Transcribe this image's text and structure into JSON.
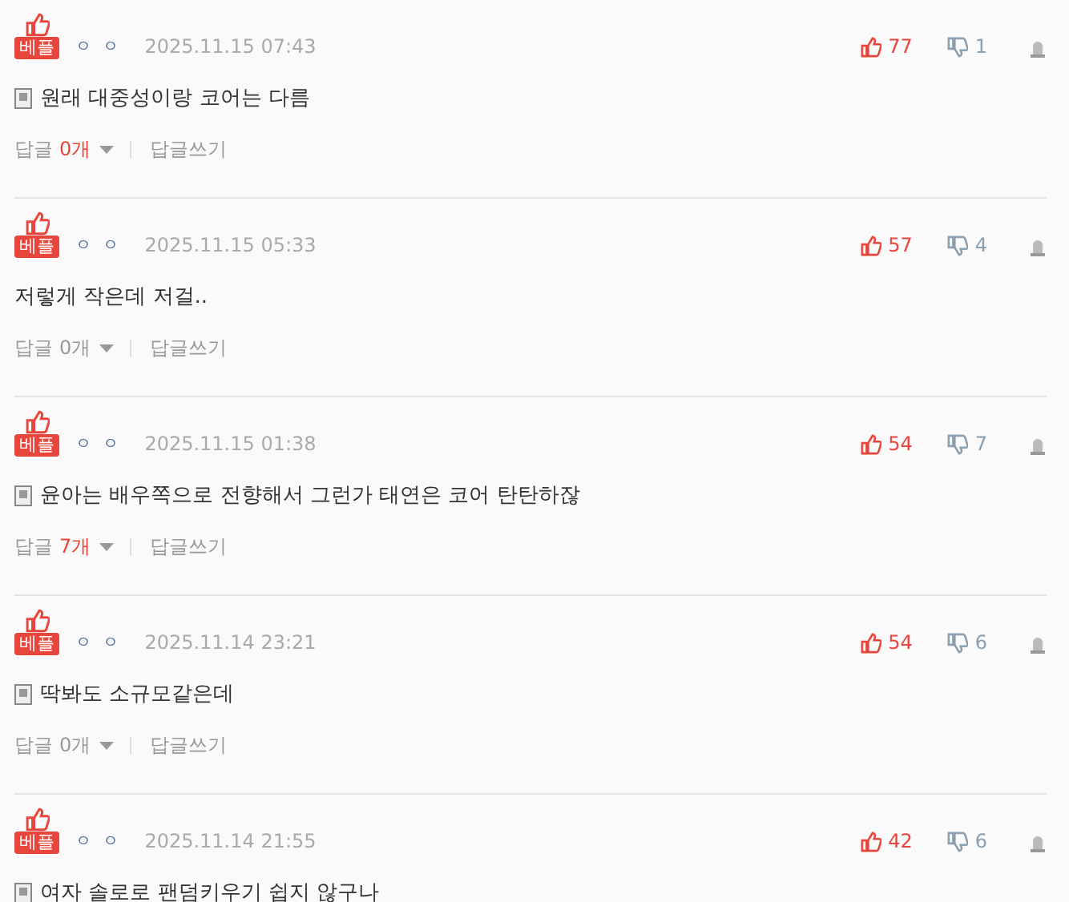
{
  "comments": [
    {
      "badge": "베플",
      "nickname": "ㅇ ㅇ",
      "date": "2025.11.15 07:43",
      "likes": "77",
      "dislikes": "1",
      "has_attachment_icon": true,
      "text": "원래 대중성이랑 코어는 다름",
      "reply_label": "답글",
      "reply_count": "0개",
      "reply_count_highlighted": true,
      "write_reply": "답글쓰기"
    },
    {
      "badge": "베플",
      "nickname": "ㅇ ㅇ",
      "date": "2025.11.15 05:33",
      "likes": "57",
      "dislikes": "4",
      "has_attachment_icon": false,
      "text": "저렇게 작은데 저걸..",
      "reply_label": "답글",
      "reply_count": "0개",
      "reply_count_highlighted": false,
      "write_reply": "답글쓰기"
    },
    {
      "badge": "베플",
      "nickname": "ㅇ ㅇ",
      "date": "2025.11.15 01:38",
      "likes": "54",
      "dislikes": "7",
      "has_attachment_icon": true,
      "text": "윤아는 배우쪽으로 전향해서 그런가 태연은 코어 탄탄하잖",
      "reply_label": "답글",
      "reply_count": "7개",
      "reply_count_highlighted": true,
      "write_reply": "답글쓰기"
    },
    {
      "badge": "베플",
      "nickname": "ㅇ ㅇ",
      "date": "2025.11.14 23:21",
      "likes": "54",
      "dislikes": "6",
      "has_attachment_icon": true,
      "text": "딱봐도 소규모같은데",
      "reply_label": "답글",
      "reply_count": "0개",
      "reply_count_highlighted": false,
      "write_reply": "답글쓰기"
    },
    {
      "badge": "베플",
      "nickname": "ㅇ ㅇ",
      "date": "2025.11.14 21:55",
      "likes": "42",
      "dislikes": "6",
      "has_attachment_icon": true,
      "text": "여자 솔로로 팬덤키우기 쉽지 않구나"
    }
  ]
}
